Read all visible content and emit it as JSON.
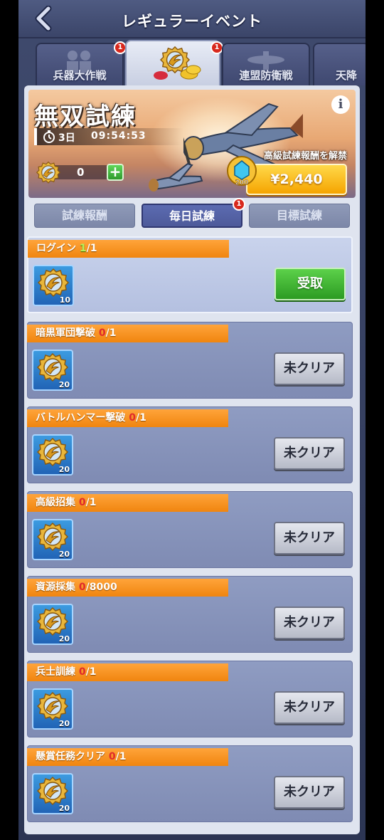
{
  "header": {
    "title": "レギュラーイベント"
  },
  "tabs": [
    {
      "label": "兵器大作戦",
      "badge": "1"
    },
    {
      "label": "",
      "badge": "1",
      "icon": "medal-coins-icon"
    },
    {
      "label": "連盟防衛戦",
      "badge": ""
    },
    {
      "label": "天降",
      "badge": ""
    }
  ],
  "banner": {
    "title": "無双試練",
    "days": "3日",
    "time": "09:54:53",
    "points": "0",
    "unlock_label": "高級試練報酬を解禁",
    "gem_amount": "200",
    "price": "¥2,440"
  },
  "subtabs": [
    {
      "label": "試練報酬",
      "badge": ""
    },
    {
      "label": "毎日試練",
      "badge": "1"
    },
    {
      "label": "目標試練",
      "badge": ""
    }
  ],
  "tasks": [
    {
      "name": "ログイン",
      "progress": "1",
      "goal": "/1",
      "reward_qty": "10",
      "action": "受取"
    },
    {
      "name": "暗黒軍団撃破",
      "progress": "0",
      "goal": "/1",
      "reward_qty": "20",
      "action": "未クリア"
    },
    {
      "name": "バトルハンマー撃破",
      "progress": "0",
      "goal": "/1",
      "reward_qty": "20",
      "action": "未クリア"
    },
    {
      "name": "高級招集",
      "progress": "0",
      "goal": "/1",
      "reward_qty": "20",
      "action": "未クリア"
    },
    {
      "name": "資源採集",
      "progress": "0",
      "goal": "/8000",
      "reward_qty": "20",
      "action": "未クリア"
    },
    {
      "name": "兵士訓練",
      "progress": "0",
      "goal": "/1",
      "reward_qty": "20",
      "action": "未クリア"
    },
    {
      "name": "懸賞任務クリア",
      "progress": "0",
      "goal": "/1",
      "reward_qty": "20",
      "action": "未クリア"
    }
  ],
  "colors": {
    "claim": "#3cb734",
    "task_header": "#f7931e",
    "accent": "#5260a8"
  }
}
